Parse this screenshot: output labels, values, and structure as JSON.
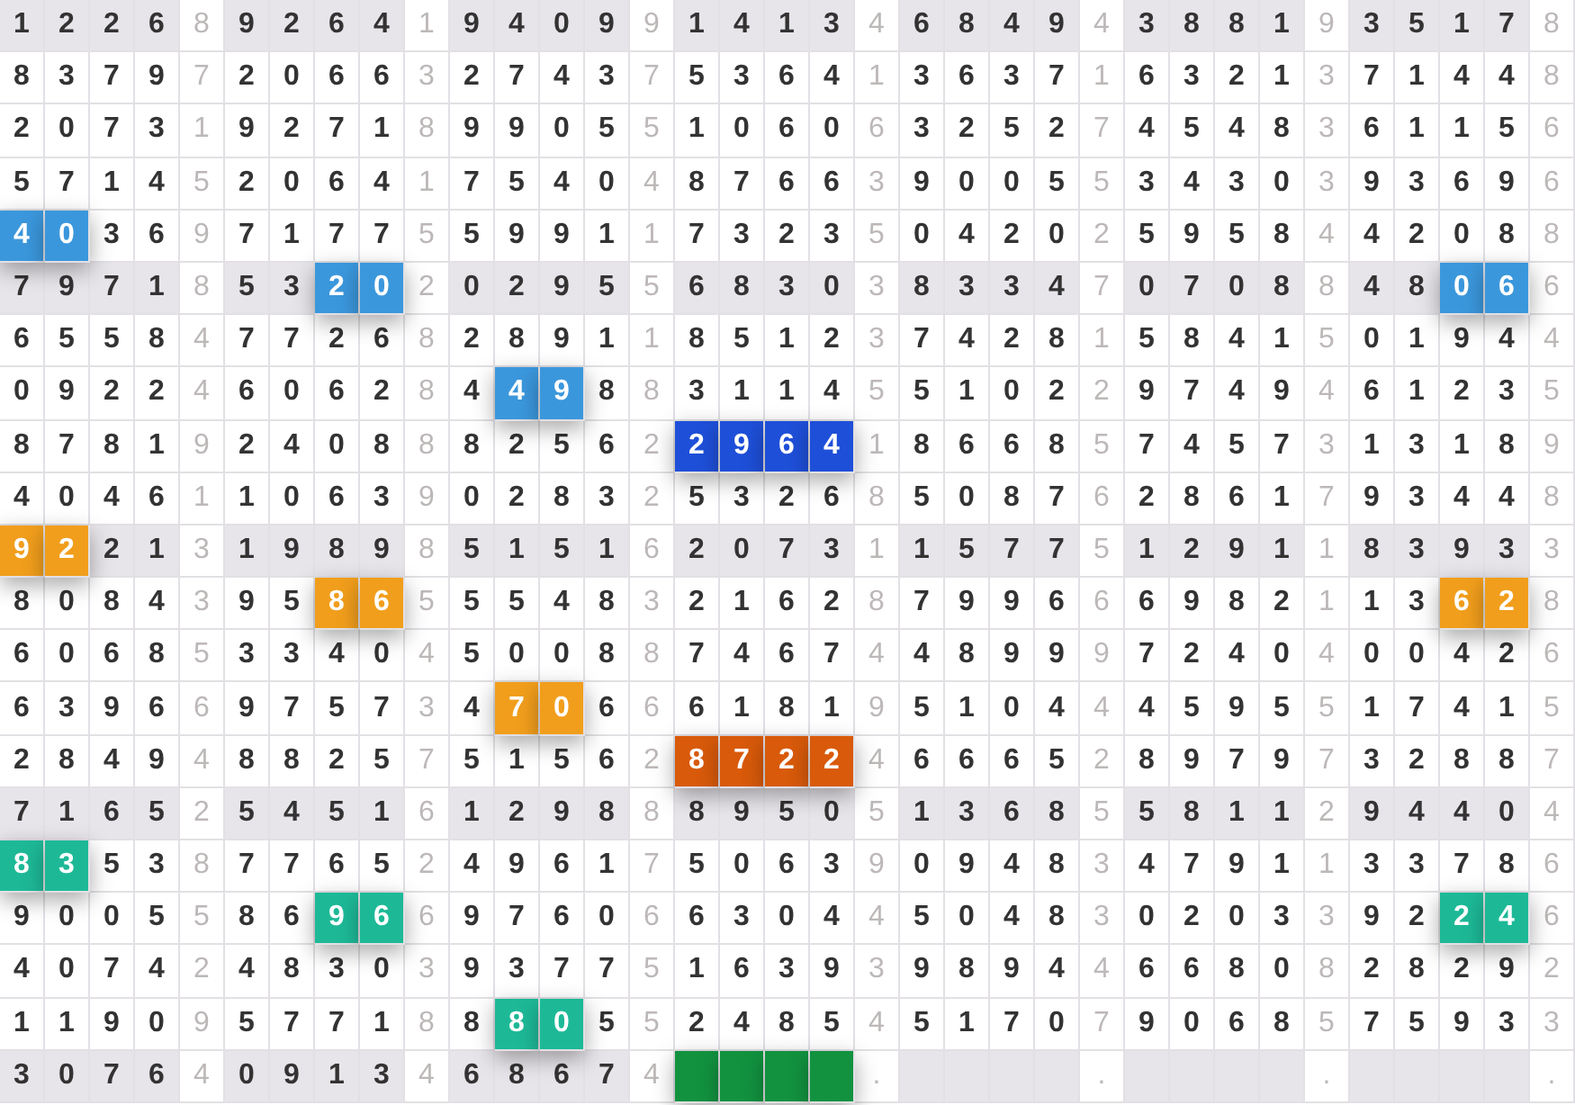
{
  "rows": [
    {
      "shaded": true,
      "cells": [
        "1",
        "2",
        "2",
        "6",
        "8",
        "9",
        "2",
        "6",
        "4",
        "1",
        "9",
        "4",
        "0",
        "9",
        "9",
        "1",
        "4",
        "1",
        "3",
        "4",
        "6",
        "8",
        "4",
        "9",
        "4",
        "3",
        "8",
        "8",
        "1",
        "9",
        "3",
        "5",
        "1",
        "7",
        "8"
      ]
    },
    {
      "shaded": false,
      "cells": [
        "8",
        "3",
        "7",
        "9",
        "7",
        "2",
        "0",
        "6",
        "6",
        "3",
        "2",
        "7",
        "4",
        "3",
        "7",
        "5",
        "3",
        "6",
        "4",
        "1",
        "3",
        "6",
        "3",
        "7",
        "1",
        "6",
        "3",
        "2",
        "1",
        "3",
        "7",
        "1",
        "4",
        "4",
        "8"
      ]
    },
    {
      "shaded": false,
      "cells": [
        "2",
        "0",
        "7",
        "3",
        "1",
        "9",
        "2",
        "7",
        "1",
        "8",
        "9",
        "9",
        "0",
        "5",
        "5",
        "1",
        "0",
        "6",
        "0",
        "6",
        "3",
        "2",
        "5",
        "2",
        "7",
        "4",
        "5",
        "4",
        "8",
        "3",
        "6",
        "1",
        "1",
        "5",
        "6"
      ]
    },
    {
      "shaded": false,
      "cells": [
        "5",
        "7",
        "1",
        "4",
        "5",
        "2",
        "0",
        "6",
        "4",
        "1",
        "7",
        "5",
        "4",
        "0",
        "4",
        "8",
        "7",
        "6",
        "6",
        "3",
        "9",
        "0",
        "0",
        "5",
        "5",
        "3",
        "4",
        "3",
        "0",
        "3",
        "9",
        "3",
        "6",
        "9",
        "6"
      ]
    },
    {
      "shaded": false,
      "cells": [
        {
          "digit": "4",
          "color": "#3b97dc"
        },
        {
          "digit": "0",
          "color": "#3b97dc"
        },
        "3",
        "6",
        "9",
        "7",
        "1",
        "7",
        "7",
        "5",
        "5",
        "9",
        "9",
        "1",
        "1",
        "7",
        "3",
        "2",
        "3",
        "5",
        "0",
        "4",
        "2",
        "0",
        "2",
        "5",
        "9",
        "5",
        "8",
        "4",
        "4",
        "2",
        "0",
        "8",
        "8"
      ]
    },
    {
      "shaded": true,
      "cells": [
        "7",
        "9",
        "7",
        "1",
        "8",
        "5",
        "3",
        {
          "digit": "2",
          "color": "#3b97dc"
        },
        {
          "digit": "0",
          "color": "#3b97dc"
        },
        "2",
        "0",
        "2",
        "9",
        "5",
        "5",
        "6",
        "8",
        "3",
        "0",
        "3",
        "8",
        "3",
        "3",
        "4",
        "7",
        "0",
        "7",
        "0",
        "8",
        "8",
        "4",
        "8",
        {
          "digit": "0",
          "color": "#3b97dc"
        },
        {
          "digit": "6",
          "color": "#3b97dc"
        },
        "6"
      ]
    },
    {
      "shaded": false,
      "cells": [
        "6",
        "5",
        "5",
        "8",
        "4",
        "7",
        "7",
        "2",
        "6",
        "8",
        "2",
        "8",
        "9",
        "1",
        "1",
        "8",
        "5",
        "1",
        "2",
        "3",
        "7",
        "4",
        "2",
        "8",
        "1",
        "5",
        "8",
        "4",
        "1",
        "5",
        "0",
        "1",
        "9",
        "4",
        "4"
      ]
    },
    {
      "shaded": false,
      "cells": [
        "0",
        "9",
        "2",
        "2",
        "4",
        "6",
        "0",
        "6",
        "2",
        "8",
        "4",
        {
          "digit": "4",
          "color": "#3b97dc"
        },
        {
          "digit": "9",
          "color": "#3b97dc"
        },
        "8",
        "8",
        "3",
        "1",
        "1",
        "4",
        "5",
        "5",
        "1",
        "0",
        "2",
        "2",
        "9",
        "7",
        "4",
        "9",
        "4",
        "6",
        "1",
        "2",
        "3",
        "5"
      ]
    },
    {
      "shaded": false,
      "cells": [
        "8",
        "7",
        "8",
        "1",
        "9",
        "2",
        "4",
        "0",
        "8",
        "8",
        "8",
        "2",
        "5",
        "6",
        "2",
        {
          "digit": "2",
          "color": "#1e4fd8"
        },
        {
          "digit": "9",
          "color": "#1e4fd8"
        },
        {
          "digit": "6",
          "color": "#1e4fd8"
        },
        {
          "digit": "4",
          "color": "#1e4fd8"
        },
        "1",
        "8",
        "6",
        "6",
        "8",
        "5",
        "7",
        "4",
        "5",
        "7",
        "3",
        "1",
        "3",
        "1",
        "8",
        "9"
      ]
    },
    {
      "shaded": false,
      "cells": [
        "4",
        "0",
        "4",
        "6",
        "1",
        "1",
        "0",
        "6",
        "3",
        "9",
        "0",
        "2",
        "8",
        "3",
        "2",
        "5",
        "3",
        "2",
        "6",
        "8",
        "5",
        "0",
        "8",
        "7",
        "6",
        "2",
        "8",
        "6",
        "1",
        "7",
        "9",
        "3",
        "4",
        "4",
        "8"
      ]
    },
    {
      "shaded": true,
      "cells": [
        {
          "digit": "9",
          "color": "#f19e1c"
        },
        {
          "digit": "2",
          "color": "#f19e1c"
        },
        "2",
        "1",
        "3",
        "1",
        "9",
        "8",
        "9",
        "8",
        "5",
        "1",
        "5",
        "1",
        "6",
        "2",
        "0",
        "7",
        "3",
        "1",
        "1",
        "5",
        "7",
        "7",
        "5",
        "1",
        "2",
        "9",
        "1",
        "1",
        "8",
        "3",
        "9",
        "3",
        "3"
      ]
    },
    {
      "shaded": false,
      "cells": [
        "8",
        "0",
        "8",
        "4",
        "3",
        "9",
        "5",
        {
          "digit": "8",
          "color": "#f19e1c"
        },
        {
          "digit": "6",
          "color": "#f19e1c"
        },
        "5",
        "5",
        "5",
        "4",
        "8",
        "3",
        "2",
        "1",
        "6",
        "2",
        "8",
        "7",
        "9",
        "9",
        "6",
        "6",
        "6",
        "9",
        "8",
        "2",
        "1",
        "1",
        "3",
        {
          "digit": "6",
          "color": "#f19e1c"
        },
        {
          "digit": "2",
          "color": "#f19e1c"
        },
        "8"
      ]
    },
    {
      "shaded": false,
      "cells": [
        "6",
        "0",
        "6",
        "8",
        "5",
        "3",
        "3",
        "4",
        "0",
        "4",
        "5",
        "0",
        "0",
        "8",
        "8",
        "7",
        "4",
        "6",
        "7",
        "4",
        "4",
        "8",
        "9",
        "9",
        "9",
        "7",
        "2",
        "4",
        "0",
        "4",
        "0",
        "0",
        "4",
        "2",
        "6"
      ]
    },
    {
      "shaded": false,
      "cells": [
        "6",
        "3",
        "9",
        "6",
        "6",
        "9",
        "7",
        "5",
        "7",
        "3",
        "4",
        {
          "digit": "7",
          "color": "#f19e1c"
        },
        {
          "digit": "0",
          "color": "#f19e1c"
        },
        "6",
        "6",
        "6",
        "1",
        "8",
        "1",
        "9",
        "5",
        "1",
        "0",
        "4",
        "4",
        "4",
        "5",
        "9",
        "5",
        "5",
        "1",
        "7",
        "4",
        "1",
        "5"
      ]
    },
    {
      "shaded": false,
      "cells": [
        "2",
        "8",
        "4",
        "9",
        "4",
        "8",
        "8",
        "2",
        "5",
        "7",
        "5",
        "1",
        "5",
        "6",
        "2",
        {
          "digit": "8",
          "color": "#d85a0a"
        },
        {
          "digit": "7",
          "color": "#d85a0a"
        },
        {
          "digit": "2",
          "color": "#d85a0a"
        },
        {
          "digit": "2",
          "color": "#d85a0a"
        },
        "4",
        "6",
        "6",
        "6",
        "5",
        "2",
        "8",
        "9",
        "7",
        "9",
        "7",
        "3",
        "2",
        "8",
        "8",
        "7"
      ]
    },
    {
      "shaded": true,
      "cells": [
        "7",
        "1",
        "6",
        "5",
        "2",
        "5",
        "4",
        "5",
        "1",
        "6",
        "1",
        "2",
        "9",
        "8",
        "8",
        "8",
        "9",
        "5",
        "0",
        "5",
        "1",
        "3",
        "6",
        "8",
        "5",
        "5",
        "8",
        "1",
        "1",
        "2",
        "9",
        "4",
        "4",
        "0",
        "4"
      ]
    },
    {
      "shaded": false,
      "cells": [
        {
          "digit": "8",
          "color": "#1db997"
        },
        {
          "digit": "3",
          "color": "#1db997"
        },
        "5",
        "3",
        "8",
        "7",
        "7",
        "6",
        "5",
        "2",
        "4",
        "9",
        "6",
        "1",
        "7",
        "5",
        "0",
        "6",
        "3",
        "9",
        "0",
        "9",
        "4",
        "8",
        "3",
        "4",
        "7",
        "9",
        "1",
        "1",
        "3",
        "3",
        "7",
        "8",
        "6"
      ]
    },
    {
      "shaded": false,
      "cells": [
        "9",
        "0",
        "0",
        "5",
        "5",
        "8",
        "6",
        {
          "digit": "9",
          "color": "#1db997"
        },
        {
          "digit": "6",
          "color": "#1db997"
        },
        "6",
        "9",
        "7",
        "6",
        "0",
        "6",
        "6",
        "3",
        "0",
        "4",
        "4",
        "5",
        "0",
        "4",
        "8",
        "3",
        "0",
        "2",
        "0",
        "3",
        "3",
        "9",
        "2",
        {
          "digit": "2",
          "color": "#1db997"
        },
        {
          "digit": "4",
          "color": "#1db997"
        },
        "6"
      ]
    },
    {
      "shaded": false,
      "cells": [
        "4",
        "0",
        "7",
        "4",
        "2",
        "4",
        "8",
        "3",
        "0",
        "3",
        "9",
        "3",
        "7",
        "7",
        "5",
        "1",
        "6",
        "3",
        "9",
        "3",
        "9",
        "8",
        "9",
        "4",
        "4",
        "6",
        "6",
        "8",
        "0",
        "8",
        "2",
        "8",
        "2",
        "9",
        "2"
      ]
    },
    {
      "shaded": false,
      "cells": [
        "1",
        "1",
        "9",
        "0",
        "9",
        "5",
        "7",
        "7",
        "1",
        "8",
        "8",
        {
          "digit": "8",
          "color": "#1db997"
        },
        {
          "digit": "0",
          "color": "#1db997"
        },
        "5",
        "5",
        "2",
        "4",
        "8",
        "5",
        "4",
        "5",
        "1",
        "7",
        "0",
        "7",
        "9",
        "0",
        "6",
        "8",
        "5",
        "7",
        "5",
        "9",
        "3",
        "3"
      ]
    },
    {
      "shaded": true,
      "cells": [
        "3",
        "0",
        "7",
        "6",
        "4",
        "0",
        "9",
        "1",
        "3",
        "4",
        "6",
        "8",
        "6",
        "7",
        "4",
        {
          "color": "#12923f"
        },
        {
          "color": "#12923f"
        },
        {
          "color": "#12923f"
        },
        {
          "color": "#12923f"
        },
        ".",
        null,
        null,
        null,
        null,
        ".",
        null,
        null,
        null,
        null,
        ".",
        null,
        null,
        null,
        null,
        "."
      ]
    }
  ]
}
